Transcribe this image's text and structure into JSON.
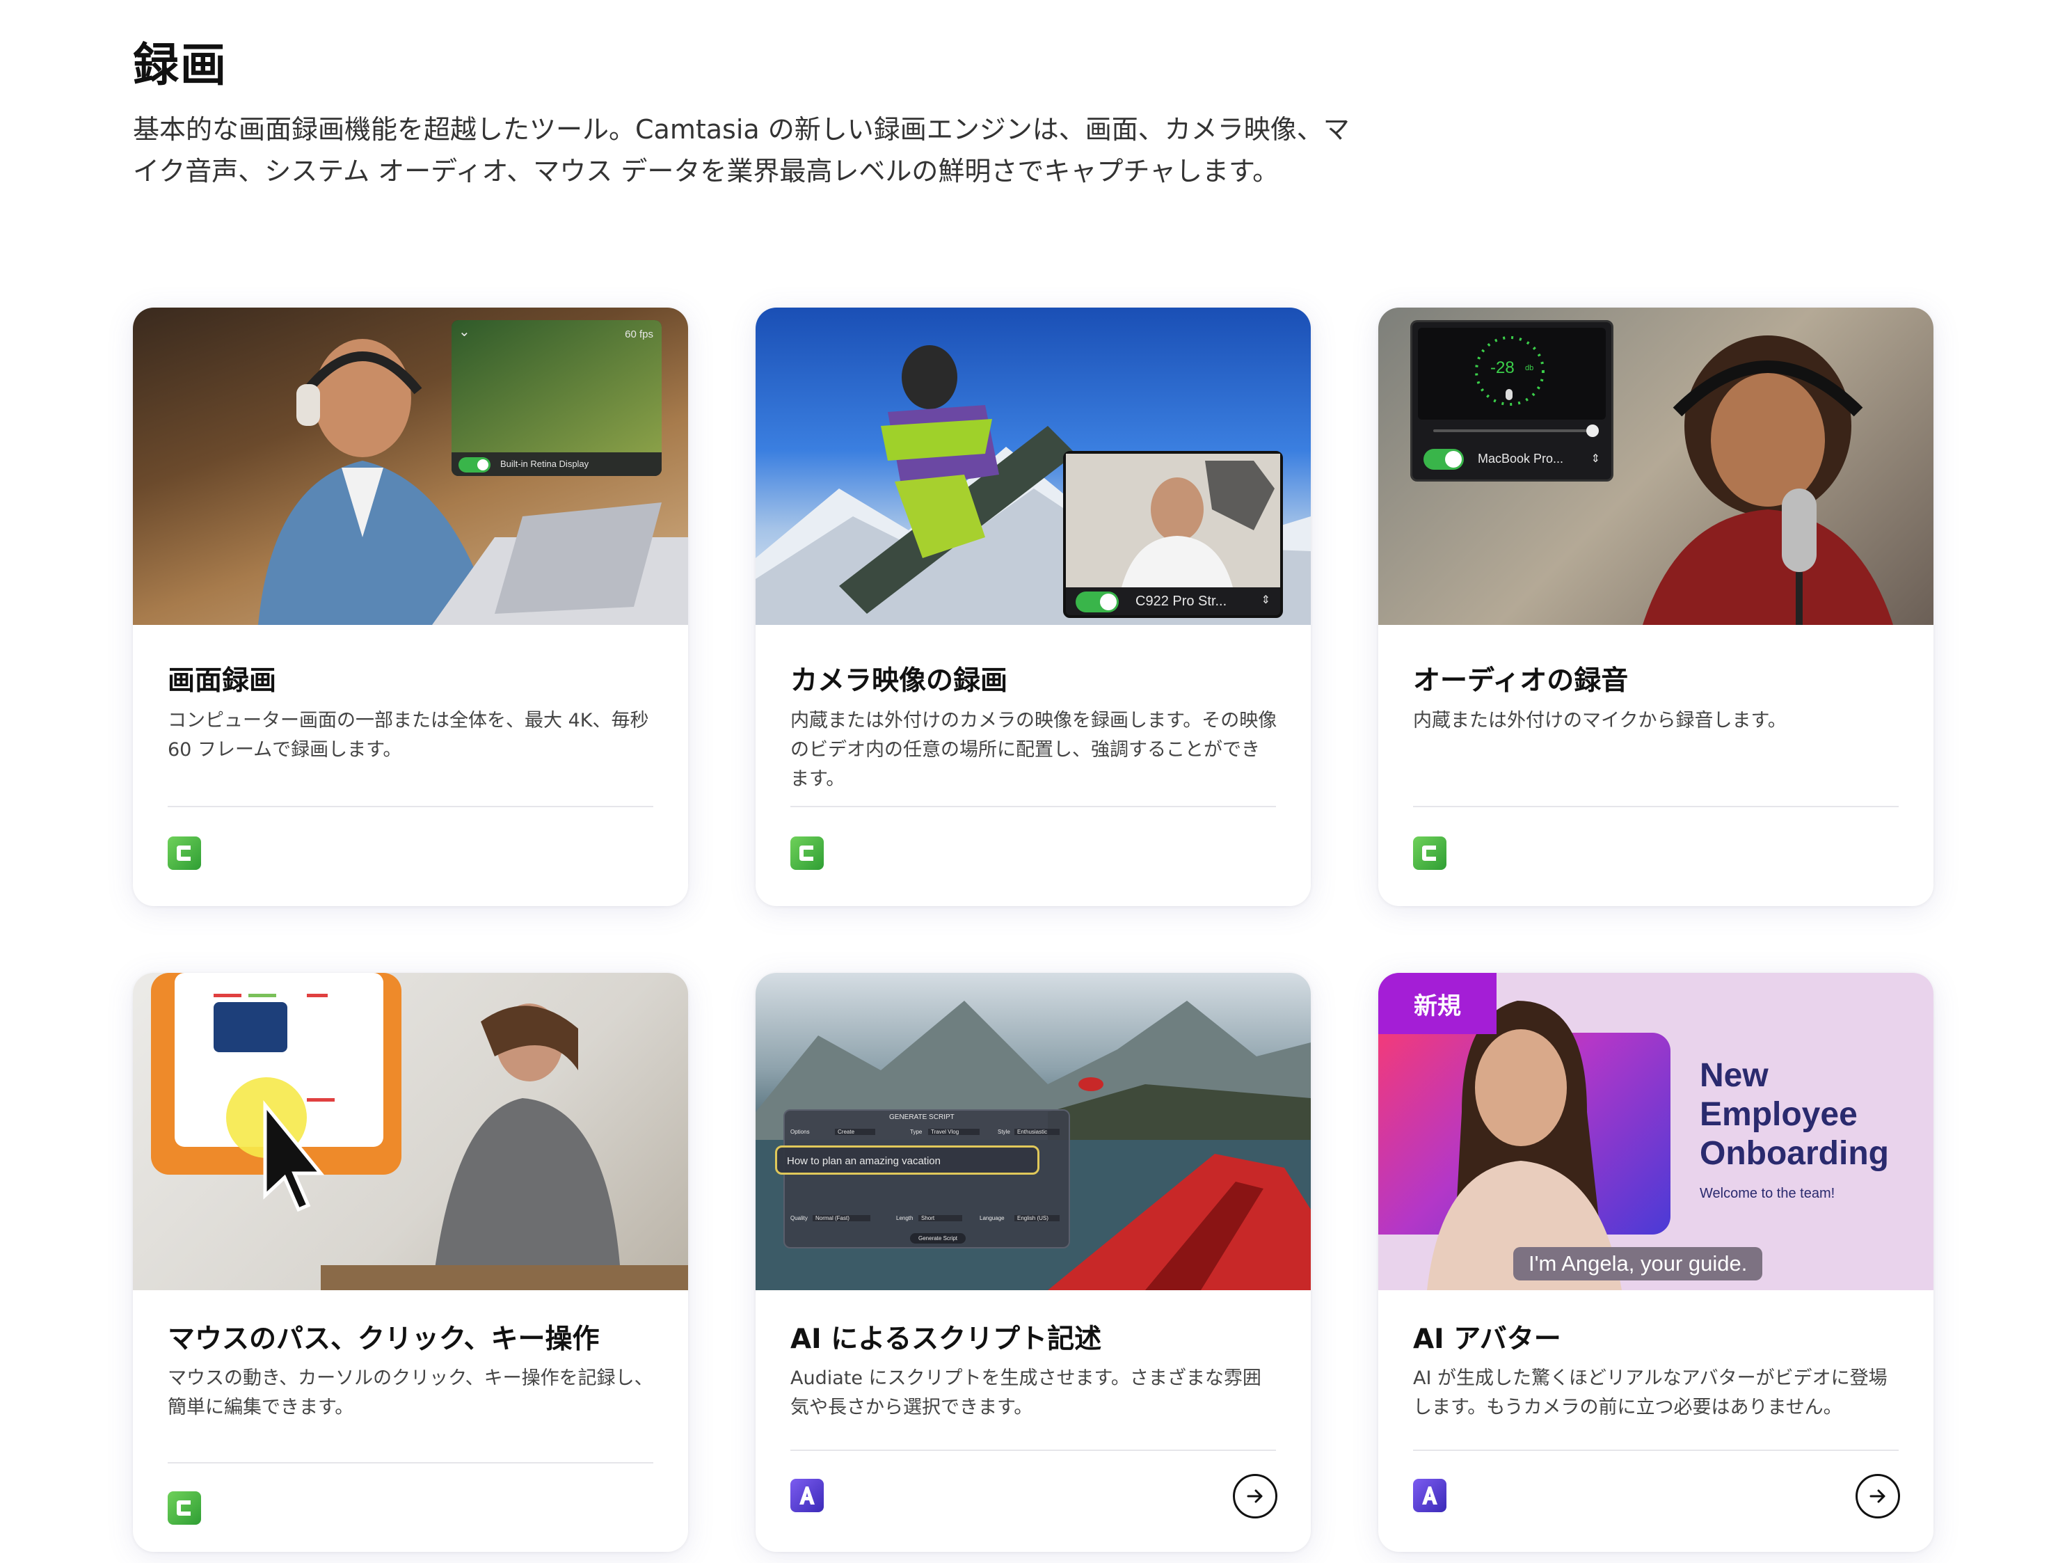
{
  "section": {
    "title": "録画",
    "description": "基本的な画面録画機能を超越したツール。Camtasia の新しい録画エンジンは、画面、カメラ映像、マイク音声、システム オーディオ、マウス データを業界最高レベルの鮮明さでキャプチャします。"
  },
  "cards": [
    {
      "title": "画面録画",
      "text": "コンピューター画面の一部または全体を、最大 4K、毎秒 60 フレームで録画します。",
      "overlay": {
        "fps": "60 fps",
        "display": "Built-in Retina Display"
      },
      "app_icon": "camtasia-icon"
    },
    {
      "title": "カメラ映像の録画",
      "text": "内蔵または外付けのカメラの映像を録画します。その映像のビデオ内の任意の場所に配置し、強調することができます。",
      "overlay": {
        "camera": "C922 Pro Str..."
      },
      "app_icon": "camtasia-icon"
    },
    {
      "title": "オーディオの録音",
      "text": "内蔵または外付けのマイクから録音します。",
      "overlay": {
        "level": "-28",
        "unit": "db",
        "mic": "MacBook Pro..."
      },
      "app_icon": "camtasia-icon"
    },
    {
      "title": "マウスのパス、クリック、キー操作",
      "text": "マウスの動き、カーソルのクリック、キー操作を記録し、簡単に編集できます。",
      "app_icon": "camtasia-icon"
    },
    {
      "title": "AI によるスクリプト記述",
      "text": "Audiate にスクリプトを生成させます。さまざまな雰囲気や長さから選択できます。",
      "overlay": {
        "header": "GENERATE SCRIPT",
        "prompt": "How to plan an amazing vacation",
        "button": "Generate Script",
        "row1": [
          "Options",
          "Create",
          "Type",
          "Travel Vlog",
          "Style",
          "Enthusiastic"
        ],
        "row2": [
          "Quality",
          "Normal (Fast)",
          "Length",
          "Short",
          "Language",
          "English (US)"
        ]
      },
      "app_icon": "audiate-icon"
    },
    {
      "title": "AI アバター",
      "text": "AI が生成した驚くほどリアルなアバターがビデオに登場します。もうカメラの前に立つ必要はありません。",
      "overlay": {
        "badge": "新規",
        "headline": "New Employee Onboarding",
        "welcome": "Welcome to the team!",
        "caption": "I'm Angela, your guide."
      },
      "app_icon": "audiate-icon"
    }
  ],
  "colors": {
    "camtasia_green": "#3faa3a",
    "audiate_purple": "#5a3fd6",
    "badge_purple": "#a41ed6",
    "headline_navy": "#2a2a6e"
  }
}
